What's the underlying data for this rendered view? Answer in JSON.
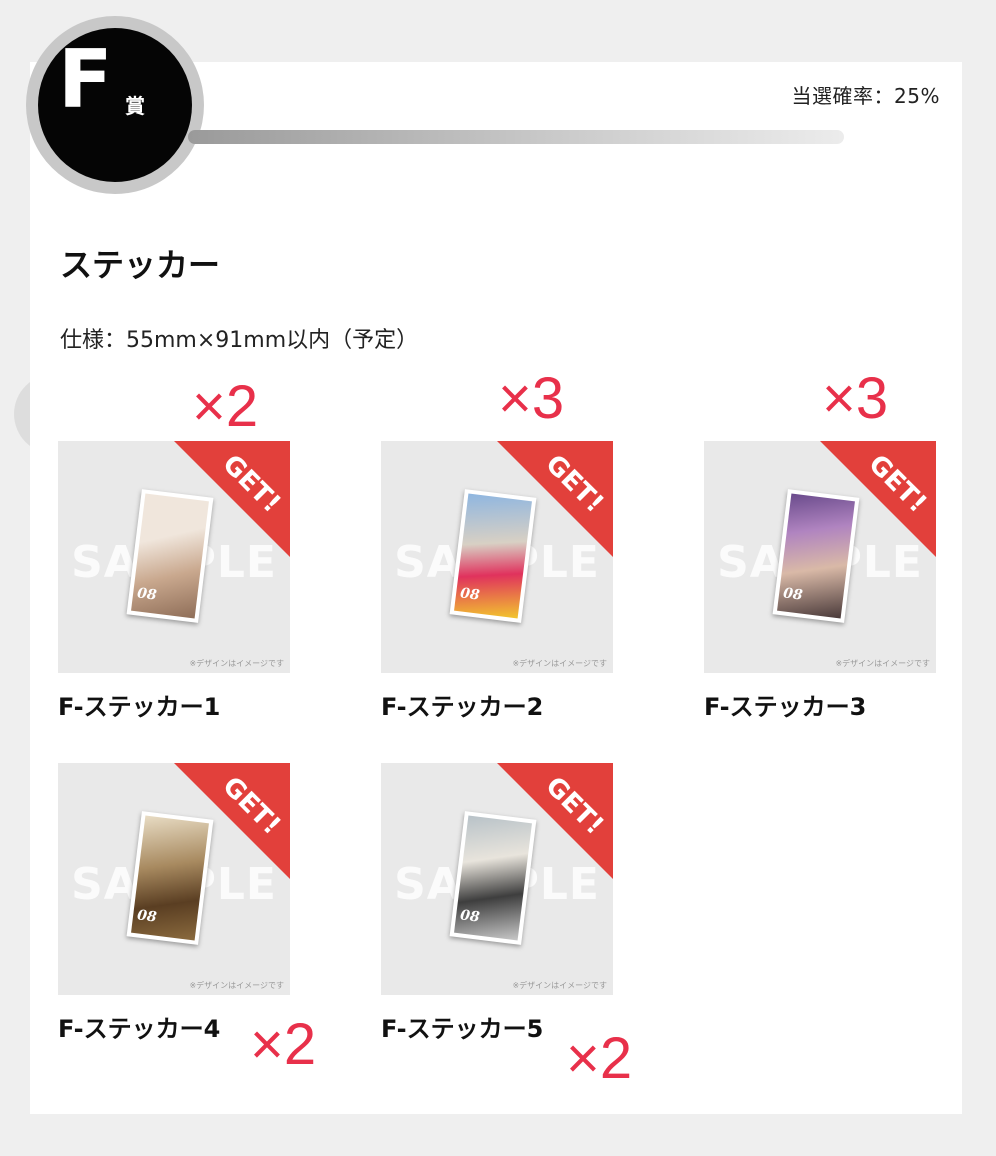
{
  "header": {
    "grade_letter": "F",
    "grade_suffix": "賞",
    "win_rate": "当選確率：25%"
  },
  "prize": {
    "title": "ステッカー",
    "spec": "仕様：55mm×91mm以内（予定）"
  },
  "thumbnail": {
    "watermark": "SAMPLE",
    "ribbon": "GET!",
    "note": "※デザインはイメージです",
    "sticker_number": "08"
  },
  "items": [
    {
      "name": "F-ステッカー1",
      "quantity": "×2",
      "colors": [
        "#f0e6dc",
        "#c9a88e"
      ]
    },
    {
      "name": "F-ステッカー2",
      "quantity": "×3",
      "colors": [
        "#8fb6e0",
        "#e0325d"
      ]
    },
    {
      "name": "F-ステッカー3",
      "quantity": "×3",
      "colors": [
        "#6a4b8c",
        "#d9b9a7"
      ]
    },
    {
      "name": "F-ステッカー4",
      "quantity": "×2",
      "colors": [
        "#e8dcc4",
        "#8a6a3e"
      ]
    },
    {
      "name": "F-ステッカー5",
      "quantity": "×2",
      "colors": [
        "#b8c2c8",
        "#3e3e3e"
      ]
    }
  ],
  "colors": {
    "ribbon": "#e2403b",
    "quantity_text": "#e8304a",
    "badge": "#050505"
  }
}
